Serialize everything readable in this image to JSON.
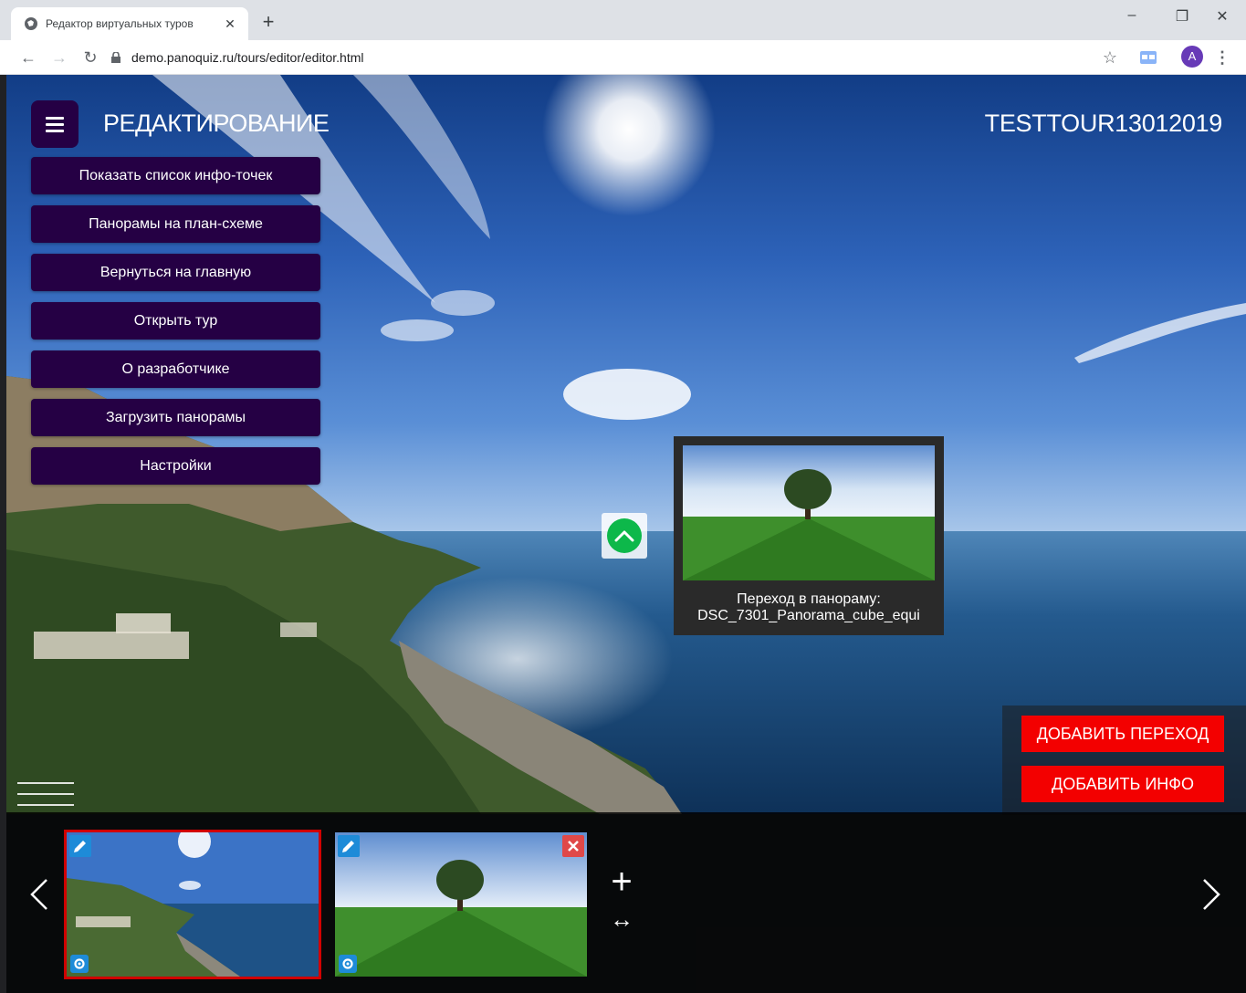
{
  "browser": {
    "tab_title": "Редактор виртуальных туров",
    "url": "demo.panoquiz.ru/tours/editor/editor.html",
    "profile_initial": "A"
  },
  "header": {
    "mode_title": "РЕДАКТИРОВАНИЕ",
    "tour_name": "TESTTOUR13012019"
  },
  "menu": {
    "items": [
      {
        "label": "Показать список инфо-точек"
      },
      {
        "label": "Панорамы на план-схеме"
      },
      {
        "label": "Вернуться на главную"
      },
      {
        "label": "Открыть тур"
      },
      {
        "label": "О разработчике"
      },
      {
        "label": "Загрузить панорамы"
      },
      {
        "label": "Настройки"
      }
    ]
  },
  "hotspot_tooltip": {
    "line1": "Переход в панораму:",
    "line2": "DSC_7301_Panorama_cube_equi"
  },
  "actions": {
    "add_transition": "ДОБАВИТЬ ПЕРЕХОД",
    "add_info": "ДОБАВИТЬ ИНФО"
  },
  "filmstrip": {
    "add_symbol": "+",
    "swap_symbol": "↔"
  },
  "colors": {
    "menu_bg": "#250044",
    "action_red": "#f30000",
    "hotspot_green": "#0db84a",
    "active_outline": "#d10000"
  }
}
